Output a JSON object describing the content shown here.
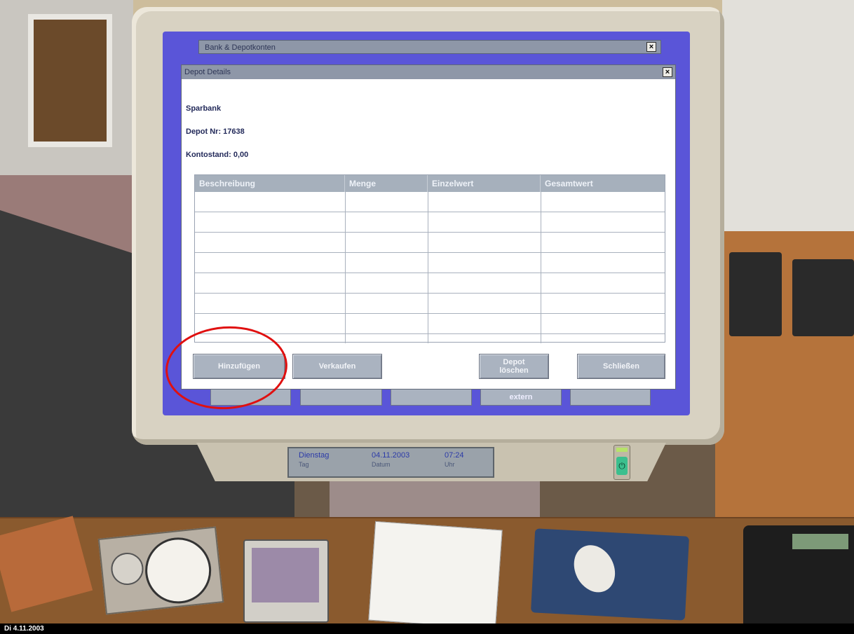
{
  "back_window": {
    "title": "Bank & Depotkonten",
    "buttons": [
      "",
      "",
      "",
      "extern",
      ""
    ]
  },
  "depot_window": {
    "title": "Depot Details",
    "bank": "Sparbank",
    "depot_nr": "Depot Nr: 17638",
    "kontostand": "Kontostand: 0,00",
    "table": {
      "columns": [
        "Beschreibung",
        "Menge",
        "Einzelwert",
        "Gesamtwert"
      ],
      "rows": []
    },
    "buttons": {
      "buy": "Hinzufügen",
      "sell": "Verkaufen",
      "delete_line1": "Depot",
      "delete_line2": "löschen",
      "close": "Schließen"
    }
  },
  "lcd": {
    "day": "Dienstag",
    "day_label": "Tag",
    "date": "04.11.2003",
    "date_label": "Datum",
    "time": "07:24",
    "time_label": "Uhr"
  },
  "status_bar": {
    "date": "Di 4.11.2003"
  },
  "colors": {
    "screen_bg": "#5a55d8",
    "titlebar": "#8e97a8",
    "button": "#aab3c0",
    "annotation": "#e01010"
  }
}
